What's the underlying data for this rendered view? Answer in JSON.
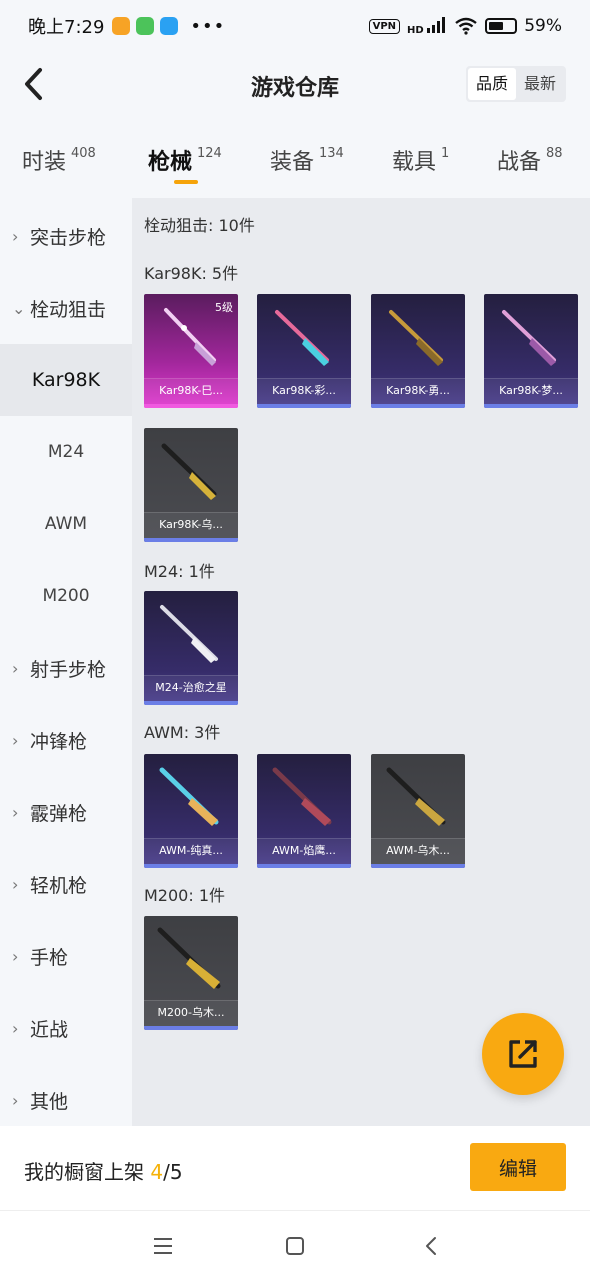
{
  "status_bar": {
    "time": "晚上7:29",
    "vpn": "VPN",
    "network": "HD",
    "battery": "59%",
    "battery_level": 0.59
  },
  "header": {
    "title": "游戏仓库",
    "sort_options": [
      "品质",
      "最新"
    ],
    "sort_active": "品质"
  },
  "tabs": [
    {
      "label": "时装",
      "count": "408"
    },
    {
      "label": "枪械",
      "count": "124"
    },
    {
      "label": "装备",
      "count": "134"
    },
    {
      "label": "载具",
      "count": "1"
    },
    {
      "label": "战备",
      "count": "88"
    }
  ],
  "active_tab": "枪械",
  "sidebar": {
    "items": [
      {
        "label": "突击步枪",
        "type": "category",
        "chevron": "›"
      },
      {
        "label": "栓动狙击",
        "type": "category",
        "chevron": "⌄"
      },
      {
        "label": "Kar98K",
        "type": "sub",
        "selected": true
      },
      {
        "label": "M24",
        "type": "sub"
      },
      {
        "label": "AWM",
        "type": "sub"
      },
      {
        "label": "M200",
        "type": "sub"
      },
      {
        "label": "射手步枪",
        "type": "category",
        "chevron": "›"
      },
      {
        "label": "冲锋枪",
        "type": "category",
        "chevron": "›"
      },
      {
        "label": "霰弹枪",
        "type": "category",
        "chevron": "›"
      },
      {
        "label": "轻机枪",
        "type": "category",
        "chevron": "›"
      },
      {
        "label": "手枪",
        "type": "category",
        "chevron": "›"
      },
      {
        "label": "近战",
        "type": "category",
        "chevron": "›"
      },
      {
        "label": "其他",
        "type": "category",
        "chevron": "›"
      }
    ]
  },
  "content": {
    "category_title": "栓动狙击: 10件",
    "sections": [
      {
        "title": "Kar98K: 5件",
        "items": [
          {
            "label": "Kar98K-巳...",
            "style": "pink",
            "level": "5级"
          },
          {
            "label": "Kar98K-彩...",
            "style": "purple"
          },
          {
            "label": "Kar98K-勇...",
            "style": "purple"
          },
          {
            "label": "Kar98K-梦...",
            "style": "purple"
          },
          {
            "label": "Kar98K-乌...",
            "style": "gray"
          }
        ]
      },
      {
        "title": "M24: 1件",
        "items": [
          {
            "label": "M24-治愈之星",
            "style": "purple"
          }
        ]
      },
      {
        "title": "AWM: 3件",
        "items": [
          {
            "label": "AWM-纯真...",
            "style": "purple"
          },
          {
            "label": "AWM-焰鹰...",
            "style": "purple"
          },
          {
            "label": "AWM-乌木...",
            "style": "gray"
          }
        ]
      },
      {
        "title": "M200: 1件",
        "items": [
          {
            "label": "M200-乌木...",
            "style": "gray"
          }
        ]
      }
    ]
  },
  "bottom": {
    "showcase_label": "我的橱窗上架",
    "showcase_current": "4",
    "showcase_total": "/5",
    "edit_label": "编辑"
  },
  "colors": {
    "accent": "#f9a911",
    "pink_card": "#e03bcf",
    "purple_card": "#362c69",
    "gray_card": "#4b4c51",
    "card_underline": "#6b7ee6"
  },
  "icons": [
    "back-arrow-icon",
    "share-icon",
    "menu-icon",
    "home-icon",
    "back-icon"
  ]
}
